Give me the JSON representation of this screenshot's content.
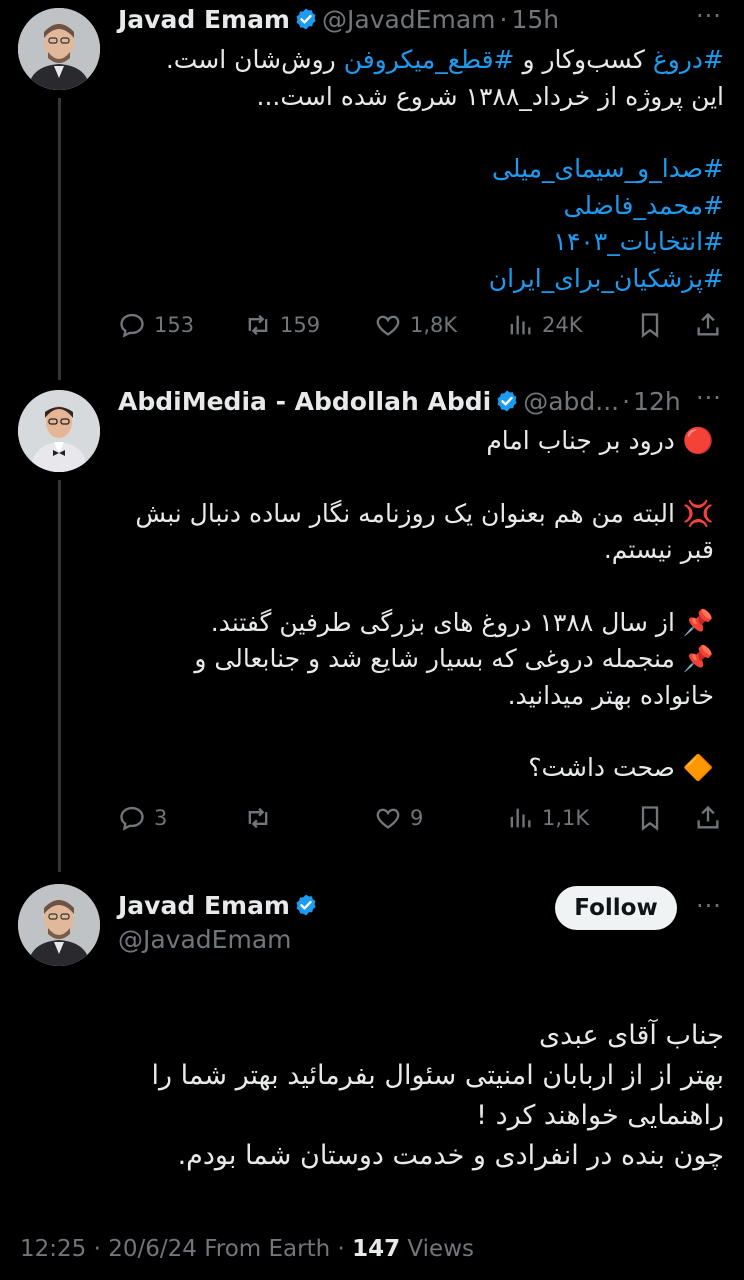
{
  "tweet1": {
    "name": "Javad Emam",
    "handle": "@JavadEmam",
    "dot": "·",
    "time": "15h",
    "line1_tag1": "#دروغ",
    "line1_mid": " کسب‌وکار و ",
    "line1_tag2": "#قطع_میکروفن",
    "line1_end": " روش‌شان است.",
    "line2": "این پروژه از خرداد_۱۳۸۸ شروع شده است...",
    "hashtags": [
      "#صدا_و_سیمای_میلی",
      "#محمد_فاضلی",
      "#انتخابات_۱۴۰۳",
      "#پزشکیان_برای_ایران"
    ],
    "replies": "153",
    "reposts": "159",
    "likes": "1,8K",
    "views": "24K"
  },
  "tweet2": {
    "name": "AbdiMedia - Abdollah Abdi",
    "handle": "@abd...",
    "dot": "·",
    "time": "12h",
    "p1": "درود بر جناب امام",
    "p1_emoji": "🔴",
    "p2": "البته من هم بعنوان یک روزنامه نگار ساده دنبال نبش قبر نیستم.",
    "p2_emoji": "💢",
    "p3a": "از سال ۱۳۸۸ دروغ های بزرگی طرفین گفتند.",
    "p3b": "منجمله دروغی که بسیار شایع شد و جنابعالی و خانواده بهتر میدانید.",
    "pin_emoji": "📌",
    "p4": "صحت داشت؟",
    "p4_emoji": "🔶",
    "replies": "3",
    "reposts": "",
    "likes": "9",
    "views": "1,1K"
  },
  "tweet3": {
    "name": "Javad Emam",
    "handle": "@JavadEmam",
    "follow_label": "Follow",
    "body_lines": [
      "جناب آقای عبدی",
      "بهتر از از اربابان امنیتی سئوال بفرمائید بهتر شما را",
      "راهنمایی خواهند کرد !",
      "چون بنده در انفرادی و خدمت دوستان شما بودم."
    ],
    "footer_time": "12:25 · 20/6/24 From Earth · ",
    "footer_views_count": "147",
    "footer_views_label": " Views"
  },
  "colors": {
    "background": "#000000",
    "text": "#e7e9ea",
    "muted": "#71767b",
    "link": "#1d9bf0",
    "verified": "#1d9bf0"
  },
  "icons": [
    "reply-icon",
    "repost-icon",
    "like-icon",
    "views-icon",
    "bookmark-icon",
    "share-icon",
    "verified-icon",
    "more-icon"
  ]
}
